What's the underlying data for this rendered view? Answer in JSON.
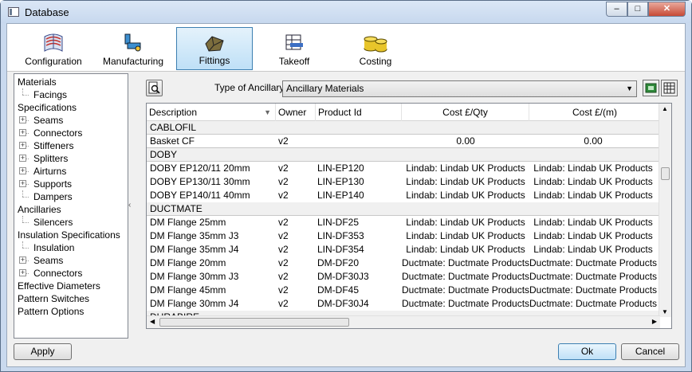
{
  "window": {
    "title": "Database",
    "min_glyph": "–",
    "max_glyph": "□",
    "close_glyph": "✕"
  },
  "toolbar": {
    "items": [
      {
        "label": "Configuration",
        "icon": "configuration-icon"
      },
      {
        "label": "Manufacturing",
        "icon": "manufacturing-icon"
      },
      {
        "label": "Fittings",
        "icon": "fittings-icon",
        "active": true
      },
      {
        "label": "Takeoff",
        "icon": "takeoff-icon"
      },
      {
        "label": "Costing",
        "icon": "costing-icon"
      }
    ]
  },
  "tree": {
    "items": [
      {
        "label": "Materials",
        "level": 0,
        "expander": ""
      },
      {
        "label": "Facings",
        "level": 1,
        "expander": ""
      },
      {
        "label": "Specifications",
        "level": 0,
        "expander": ""
      },
      {
        "label": "Seams",
        "level": 1,
        "expander": "+"
      },
      {
        "label": "Connectors",
        "level": 1,
        "expander": "+"
      },
      {
        "label": "Stiffeners",
        "level": 1,
        "expander": "+"
      },
      {
        "label": "Splitters",
        "level": 1,
        "expander": "+"
      },
      {
        "label": "Airturns",
        "level": 1,
        "expander": "+"
      },
      {
        "label": "Supports",
        "level": 1,
        "expander": "+"
      },
      {
        "label": "Dampers",
        "level": 1,
        "expander": ""
      },
      {
        "label": "Ancillaries",
        "level": 0,
        "expander": ""
      },
      {
        "label": "Silencers",
        "level": 1,
        "expander": ""
      },
      {
        "label": "Insulation Specifications",
        "level": 0,
        "expander": ""
      },
      {
        "label": "Insulation",
        "level": 1,
        "expander": ""
      },
      {
        "label": "Seams",
        "level": 1,
        "expander": "+"
      },
      {
        "label": "Connectors",
        "level": 1,
        "expander": "+"
      },
      {
        "label": "Effective Diameters",
        "level": 0,
        "expander": ""
      },
      {
        "label": "Pattern Switches",
        "level": 0,
        "expander": ""
      },
      {
        "label": "Pattern Options",
        "level": 0,
        "expander": ""
      }
    ]
  },
  "filter": {
    "type_label": "Type of Ancillary",
    "type_value": "Ancillary Materials"
  },
  "grid": {
    "columns": [
      "Description",
      "Owner",
      "Product Id",
      "Cost £/Qty",
      "Cost £/(m)"
    ],
    "rows": [
      {
        "group": "CABLOFIL"
      },
      {
        "cells": [
          "Basket CF",
          "v2",
          "",
          "0.00",
          "0.00"
        ],
        "highlight": true
      },
      {
        "group": "DOBY"
      },
      {
        "cells": [
          "DOBY EP120/11 20mm",
          "v2",
          "LIN-EP120",
          "Lindab: Lindab UK Products",
          "Lindab: Lindab UK Products"
        ]
      },
      {
        "cells": [
          "DOBY EP130/11 30mm",
          "v2",
          "LIN-EP130",
          "Lindab: Lindab UK Products",
          "Lindab: Lindab UK Products"
        ]
      },
      {
        "cells": [
          "DOBY EP140/11 40mm",
          "v2",
          "LIN-EP140",
          "Lindab: Lindab UK Products",
          "Lindab: Lindab UK Products"
        ]
      },
      {
        "group": "DUCTMATE"
      },
      {
        "cells": [
          "DM Flange 25mm",
          "v2",
          "LIN-DF25",
          "Lindab: Lindab UK Products",
          "Lindab: Lindab UK Products"
        ]
      },
      {
        "cells": [
          "DM Flange 35mm J3",
          "v2",
          "LIN-DF353",
          "Lindab: Lindab UK Products",
          "Lindab: Lindab UK Products"
        ]
      },
      {
        "cells": [
          "DM Flange 35mm J4",
          "v2",
          "LIN-DF354",
          "Lindab: Lindab UK Products",
          "Lindab: Lindab UK Products"
        ]
      },
      {
        "cells": [
          "DM Flange 20mm",
          "v2",
          "DM-DF20",
          "Ductmate: Ductmate Products",
          "Ductmate: Ductmate Products"
        ]
      },
      {
        "cells": [
          "DM Flange 30mm J3",
          "v2",
          "DM-DF30J3",
          "Ductmate: Ductmate Products",
          "Ductmate: Ductmate Products"
        ]
      },
      {
        "cells": [
          "DM Flange 45mm",
          "v2",
          "DM-DF45",
          "Ductmate: Ductmate Products",
          "Ductmate: Ductmate Products"
        ]
      },
      {
        "cells": [
          "DM Flange 30mm J4",
          "v2",
          "DM-DF30J4",
          "Ductmate: Ductmate Products",
          "Ductmate: Ductmate Products"
        ]
      },
      {
        "group": "DURABIRE"
      }
    ]
  },
  "buttons": {
    "apply": "Apply",
    "ok": "Ok",
    "cancel": "Cancel"
  }
}
